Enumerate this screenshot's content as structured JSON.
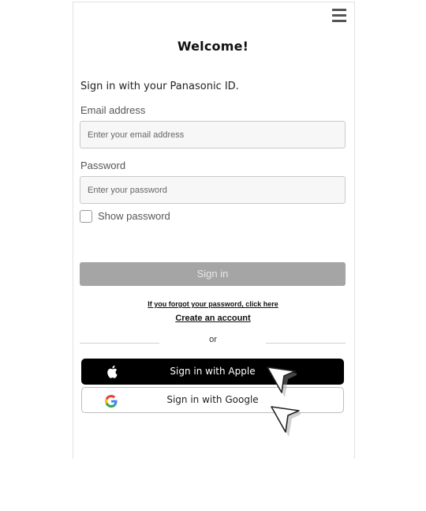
{
  "header": {
    "menu_icon": "hamburger-menu-icon",
    "title": "Welcome!"
  },
  "form": {
    "intro": "Sign in with your Panasonic ID.",
    "email_label": "Email address",
    "email_placeholder": "Enter your email address",
    "email_value": "",
    "password_label": "Password",
    "password_placeholder": "Enter your password",
    "password_value": "",
    "show_password_label": "Show password",
    "show_password_checked": false,
    "signin_label": "Sign in",
    "forgot_link": "If you forgot your password, click here",
    "create_account_link": "Create an account",
    "or_text": "or"
  },
  "social": {
    "apple_label": "Sign in with Apple",
    "apple_icon": "apple-logo-icon",
    "google_label": "Sign in with Google",
    "google_icon": "google-logo-icon"
  },
  "overlays": {
    "cursor_icon": "mouse-pointer-arrow-icon"
  },
  "colors": {
    "apple_button_bg": "#000000",
    "signin_disabled_bg": "#a5a5a5",
    "field_bg": "#f7f7f7"
  }
}
